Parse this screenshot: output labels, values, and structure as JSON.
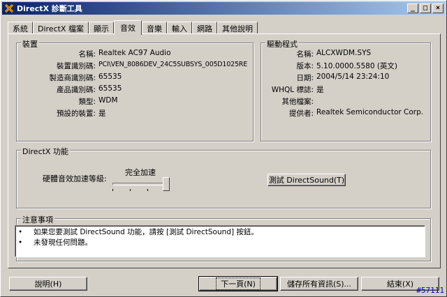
{
  "window": {
    "title": "DirectX 診斷工具",
    "minimize_glyph": "_",
    "maximize_glyph": "□",
    "close_glyph": "×"
  },
  "tabs": [
    {
      "label": "系統"
    },
    {
      "label": "DirectX 檔案"
    },
    {
      "label": "顯示"
    },
    {
      "label": "音效",
      "active": true
    },
    {
      "label": "音樂"
    },
    {
      "label": "輸入"
    },
    {
      "label": "網路"
    },
    {
      "label": "其他說明"
    }
  ],
  "device": {
    "group_label": "裝置",
    "rows": [
      {
        "key": "名稱:",
        "value": "Realtek AC97 Audio"
      },
      {
        "key": "裝置識別碼:",
        "value": "PCI\\VEN_8086DEV_24C5SUBSYS_005D1025RE"
      },
      {
        "key": "製造商識別碼:",
        "value": "65535"
      },
      {
        "key": "產品識別碼:",
        "value": "65535"
      },
      {
        "key": "類型:",
        "value": "WDM"
      },
      {
        "key": "預設的裝置:",
        "value": "是"
      }
    ]
  },
  "driver": {
    "group_label": "驅動程式",
    "rows": [
      {
        "key": "名稱:",
        "value": "ALCXWDM.SYS"
      },
      {
        "key": "版本:",
        "value": "5.10.0000.5580 (英文)"
      },
      {
        "key": "日期:",
        "value": "2004/5/14 23:24:10"
      },
      {
        "key": "WHQL 標誌:",
        "value": "是"
      },
      {
        "key": "其他檔案:",
        "value": ""
      },
      {
        "key": "提供者:",
        "value": "Realtek Semiconductor Corp."
      }
    ]
  },
  "directx": {
    "group_label": "DirectX 功能",
    "accel_label": "硬體音效加速等級:",
    "accel_value": "完全加速",
    "accel_level": 1.0,
    "test_button": "測試 DirectSound(T)"
  },
  "notes": {
    "group_label": "注意事項",
    "items": [
      {
        "bullet": "•",
        "text": "如果您要測試 DirectSound 功能，請按 [測試 DirectSound] 按鈕。"
      },
      {
        "bullet": "•",
        "text": "未發現任何問題。"
      }
    ]
  },
  "footer": {
    "help_button": "說明(H)",
    "next_button": "下一頁(N)",
    "save_button": "儲存所有資訊(S)...",
    "exit_button": "結束(X)"
  },
  "watermark": "#57111"
}
